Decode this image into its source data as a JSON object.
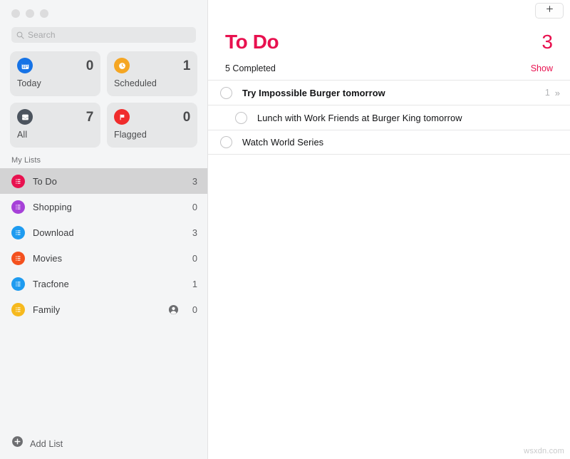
{
  "window": {
    "traffic_lights": [
      "close",
      "minimize",
      "zoom"
    ]
  },
  "sidebar": {
    "search": {
      "placeholder": "Search",
      "value": "",
      "icon": "search-icon"
    },
    "smart_cards": [
      {
        "label": "Today",
        "count": "0",
        "icon": "calendar-icon",
        "color": "#1673E6"
      },
      {
        "label": "Scheduled",
        "count": "1",
        "icon": "clock-icon",
        "color": "#F5A623"
      },
      {
        "label": "All",
        "count": "7",
        "icon": "inbox-tray-icon",
        "color": "#4C545E"
      },
      {
        "label": "Flagged",
        "count": "0",
        "icon": "flag-icon",
        "color": "#F02C2C"
      }
    ],
    "section_title": "My Lists",
    "lists": [
      {
        "label": "To Do",
        "count": "3",
        "color": "#E8114F",
        "selected": true,
        "shared": false
      },
      {
        "label": "Shopping",
        "count": "0",
        "color": "#A641D8",
        "selected": false,
        "shared": false
      },
      {
        "label": "Download",
        "count": "3",
        "color": "#1E9BF0",
        "selected": false,
        "shared": false
      },
      {
        "label": "Movies",
        "count": "0",
        "color": "#F4511E",
        "selected": false,
        "shared": false
      },
      {
        "label": "Tracfone",
        "count": "1",
        "color": "#1E9BF0",
        "selected": false,
        "shared": false
      },
      {
        "label": "Family",
        "count": "0",
        "color": "#F6B91E",
        "selected": false,
        "shared": true,
        "shared_icon": "person-circle-icon"
      }
    ],
    "add_list": {
      "label": "Add List",
      "icon": "plus-circle-icon"
    }
  },
  "main": {
    "toolbar": {
      "add_button_icon": "plus-icon",
      "add_button_label": "+"
    },
    "title": "To Do",
    "total": "3",
    "accent_color": "#E8114F",
    "completed_label": "5 Completed",
    "show_label": "Show",
    "tasks": [
      {
        "text": "Try Impossible Burger tomorrow",
        "bold": true,
        "indent": 0,
        "subtask_count": "1",
        "chevron": "»",
        "checkbox": "circle-unchecked-icon"
      },
      {
        "text": "Lunch with Work Friends at Burger King tomorrow",
        "bold": false,
        "indent": 1,
        "subtask_count": "",
        "chevron": "",
        "checkbox": "circle-unchecked-icon"
      },
      {
        "text": "Watch World Series",
        "bold": false,
        "indent": 0,
        "subtask_count": "",
        "chevron": "",
        "checkbox": "circle-unchecked-icon"
      }
    ]
  },
  "watermark": "wsxdn.com"
}
